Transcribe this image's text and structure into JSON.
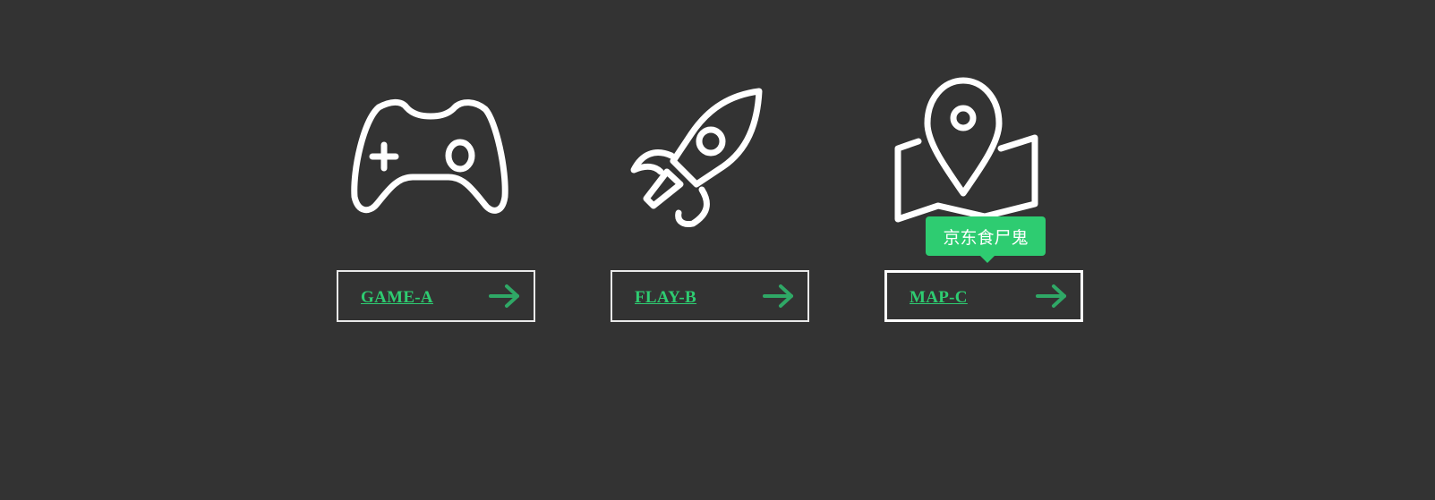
{
  "page": {
    "background": "#333333",
    "accent_color": "#2ecc71",
    "icon_color": "#ffffff"
  },
  "items": [
    {
      "label": "GAME-A",
      "icon": "gamepad-icon",
      "arrow": "arrow-right-icon"
    },
    {
      "label": "FLAY-B",
      "icon": "rocket-icon",
      "arrow": "arrow-right-icon"
    },
    {
      "label": "MAP-C",
      "icon": "map-pin-icon",
      "arrow": "arrow-right-icon"
    }
  ],
  "tooltip": {
    "text": "京东食尸鬼",
    "target": "MAP-C"
  }
}
